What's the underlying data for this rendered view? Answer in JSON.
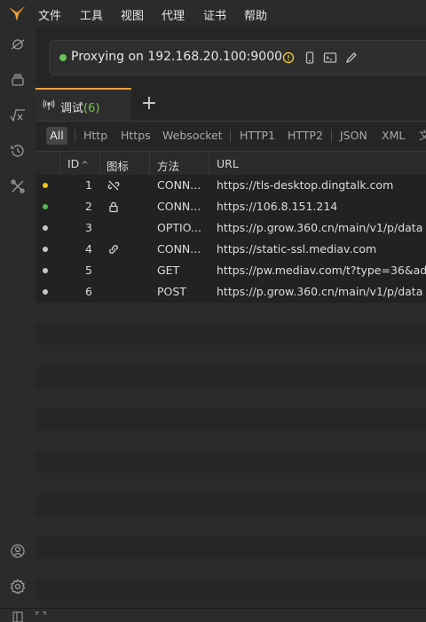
{
  "menu": [
    "文件",
    "工具",
    "视图",
    "代理",
    "证书",
    "帮助"
  ],
  "proxy": {
    "status_text": "Proxying on 192.168.20.100:9000",
    "status_color": "#6ac259",
    "warning_color": "#e8c131"
  },
  "tabs": [
    {
      "label": "调试",
      "count": "(6)",
      "icon": "antenna-icon"
    }
  ],
  "add_tab_label": "+",
  "filters": [
    "All",
    "Http",
    "Https",
    "Websocket",
    "HTTP1",
    "HTTP2",
    "JSON",
    "XML",
    "文"
  ],
  "active_filter": "All",
  "table": {
    "headers": {
      "id": "ID",
      "sort": "^",
      "icon": "图标",
      "method": "方法",
      "url": "URL"
    },
    "rows": [
      {
        "dot_color": "#f5c518",
        "id": "1",
        "icon": "unlinked-icon",
        "method": "CONN...",
        "url": "https://tls-desktop.dingtalk.com"
      },
      {
        "dot_color": "#5ab552",
        "id": "2",
        "icon": "lock-icon",
        "method": "CONN...",
        "url": "https://106.8.151.214"
      },
      {
        "dot_color": "#c8c8c8",
        "id": "3",
        "icon": "",
        "method": "OPTIO...",
        "url": "https://p.grow.360.cn/main/v1/p/data"
      },
      {
        "dot_color": "#c8c8c8",
        "id": "4",
        "icon": "link-icon",
        "method": "CONN...",
        "url": "https://static-ssl.mediav.com"
      },
      {
        "dot_color": "#c8c8c8",
        "id": "5",
        "icon": "",
        "method": "GET",
        "url": "https://pw.mediav.com/t?type=36&ad"
      },
      {
        "dot_color": "#c8c8c8",
        "id": "6",
        "icon": "",
        "method": "POST",
        "url": "https://p.grow.360.cn/main/v1/p/data"
      }
    ]
  },
  "colors": {
    "accent": "#f2a33a",
    "background": "#252525"
  }
}
